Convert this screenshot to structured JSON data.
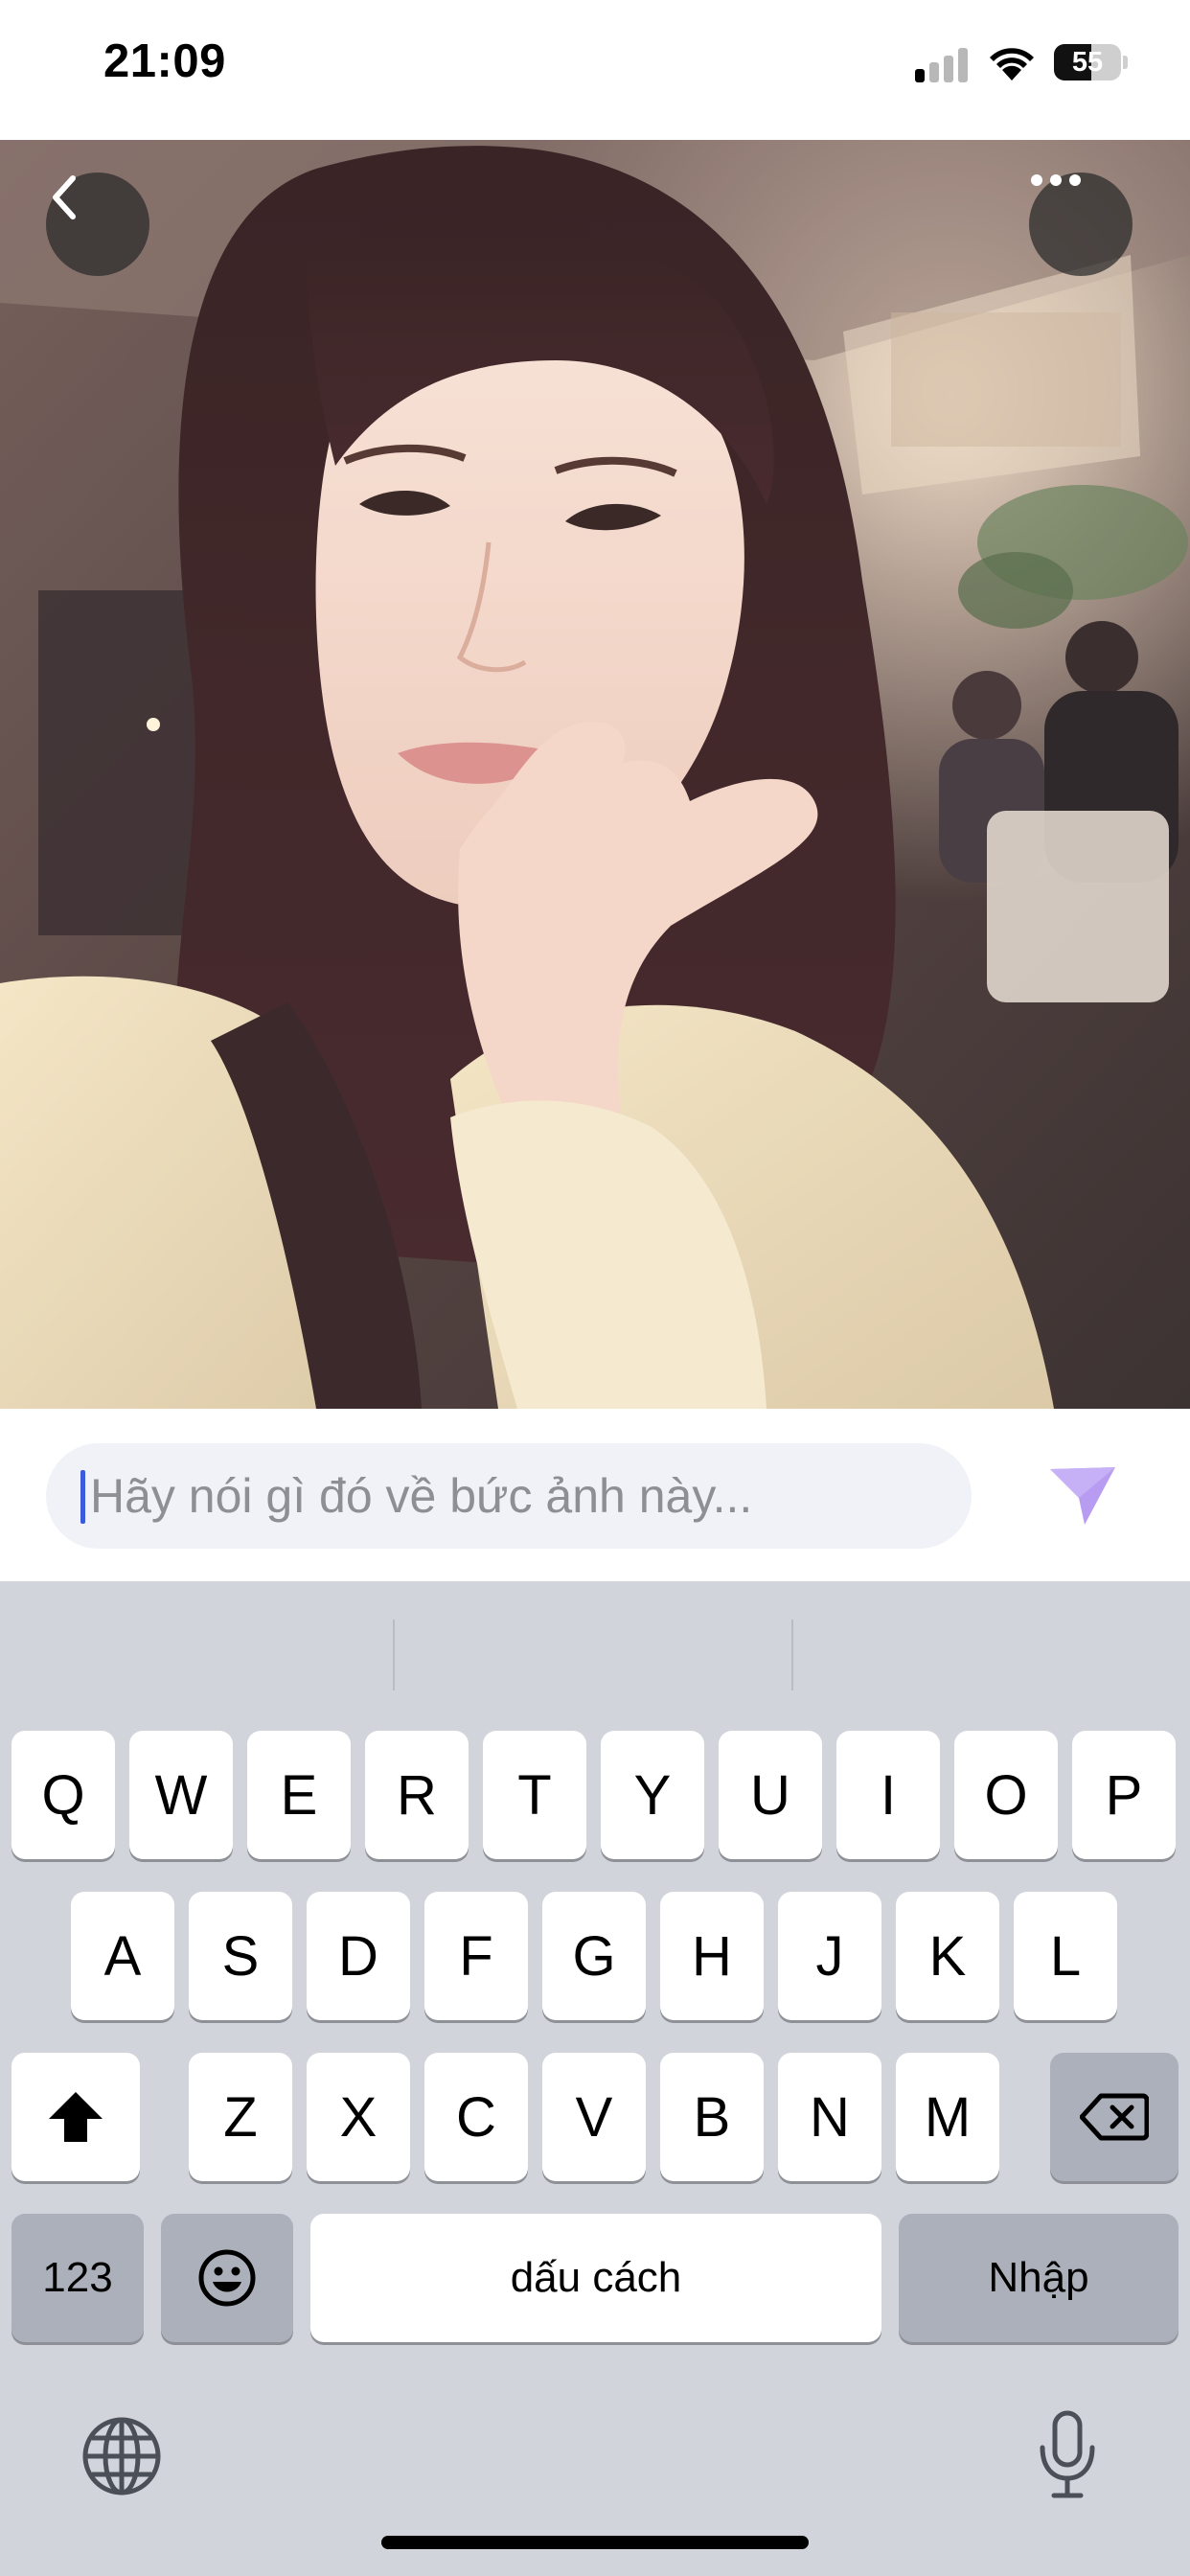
{
  "status_bar": {
    "time": "21:09",
    "battery": "55",
    "battery_level": 0.55,
    "signal_bars_active": 1,
    "icons": [
      "cellular-signal-icon",
      "wifi-icon",
      "battery-icon"
    ]
  },
  "photo": {
    "back_icon": "chevron-left-icon",
    "more_icon": "ellipsis-icon"
  },
  "comment": {
    "placeholder": "Hãy nói gì đó về bức ảnh này...",
    "value": "",
    "send_icon": "send-arrow-icon",
    "send_color": "#b79cf2"
  },
  "keyboard": {
    "row1": [
      "Q",
      "W",
      "E",
      "R",
      "T",
      "Y",
      "U",
      "I",
      "O",
      "P"
    ],
    "row2": [
      "A",
      "S",
      "D",
      "F",
      "G",
      "H",
      "J",
      "K",
      "L"
    ],
    "row3": [
      "Z",
      "X",
      "C",
      "V",
      "B",
      "N",
      "M"
    ],
    "shift_icon": "shift-arrow-icon",
    "delete_icon": "backspace-icon",
    "numbers_label": "123",
    "emoji_icon": "emoji-icon",
    "space_label": "dấu cách",
    "return_label": "Nhập",
    "globe_icon": "globe-icon",
    "mic_icon": "microphone-icon"
  }
}
